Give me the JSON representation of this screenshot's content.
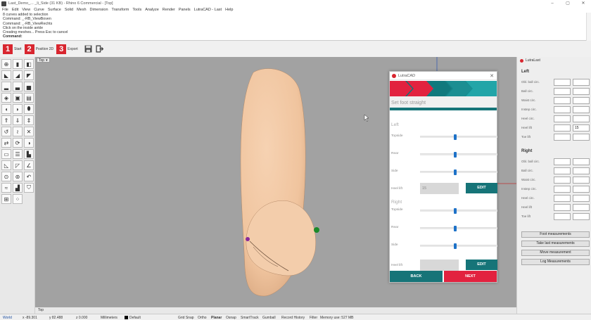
{
  "window": {
    "title": "Last_Demo_... _li_Side (31 KB) - Rhino 6 Commercial - [Top]",
    "controls": [
      "–",
      "▢",
      "✕"
    ]
  },
  "menu": [
    "File",
    "Edit",
    "View",
    "Curve",
    "Surface",
    "Solid",
    "Mesh",
    "Dimension",
    "Transform",
    "Tools",
    "Analyze",
    "Render",
    "Panels",
    "LutraCAD - Last",
    "Help"
  ],
  "command_history": [
    "8 curves added to selection",
    "Command: _-RB_ViewBoven",
    "Command: _-RB_ViewRechts",
    "Click on the inside ankle",
    "Creating meshes... Press Esc to cancel"
  ],
  "command_prompt": "Command:",
  "steps": [
    {
      "num": "1",
      "label": "Start"
    },
    {
      "num": "2",
      "label": "Position 2D"
    },
    {
      "num": "3",
      "label": "Export"
    }
  ],
  "toolbar_icons": [
    "save-icon",
    "exit-icon"
  ],
  "viewport": {
    "tab": "Top",
    "tab_arrow": "▾",
    "bottom_tab": "Top",
    "background": "#a2a2a2",
    "foot_color": "#f2caa6"
  },
  "dialog": {
    "title": "LutraCAD",
    "close": "✕",
    "section_title": "Set foot straight",
    "left": {
      "label": "Left",
      "rows": [
        {
          "label": "Topside",
          "value": 0.45
        },
        {
          "label": "Rear",
          "value": 0.45
        },
        {
          "label": "Side",
          "value": 0.45
        }
      ],
      "heel_lift_label": "Heel lift",
      "heel_lift_value": "15",
      "edit_label": "EDIT"
    },
    "right": {
      "label": "Right",
      "rows": [
        {
          "label": "Topside",
          "value": 0.45
        },
        {
          "label": "Rear",
          "value": 0.45
        },
        {
          "label": "Side",
          "value": 0.45
        }
      ],
      "heel_lift_label": "Heel lift",
      "heel_lift_value": "",
      "edit_label": "EDIT"
    },
    "back_label": "BACK",
    "next_label": "NEXT",
    "colors": {
      "teal": "#167478",
      "red": "#e2223f",
      "slider": "#1e72c8"
    }
  },
  "panel": {
    "title": "LutraLast",
    "left": {
      "label": "Left",
      "rows": [
        {
          "label": "Obl. ball circ.",
          "a": "",
          "b": ""
        },
        {
          "label": "Ball circ.",
          "a": "",
          "b": ""
        },
        {
          "label": "Waist circ.",
          "a": "",
          "b": ""
        },
        {
          "label": "Instep circ.",
          "a": "",
          "b": ""
        },
        {
          "label": "Heel circ.",
          "a": "",
          "b": ""
        },
        {
          "label": "Heel lift",
          "a": "",
          "b": "15"
        },
        {
          "label": "Toe lift",
          "a": "",
          "b": ""
        }
      ]
    },
    "right": {
      "label": "Right",
      "rows": [
        {
          "label": "Obl. ball circ.",
          "a": "",
          "b": ""
        },
        {
          "label": "Ball circ.",
          "a": "",
          "b": ""
        },
        {
          "label": "Waist circ.",
          "a": "",
          "b": ""
        },
        {
          "label": "Instep circ.",
          "a": "",
          "b": ""
        },
        {
          "label": "Heel circ.",
          "a": "",
          "b": ""
        },
        {
          "label": "Heel lift",
          "a": "",
          "b": ""
        },
        {
          "label": "Toe lift",
          "a": "",
          "b": ""
        }
      ]
    },
    "buttons": [
      "Foot measurements",
      "Take last measurements",
      "Move measurement",
      "Log Measurements"
    ]
  },
  "status": {
    "world": "World",
    "x": "x -89.301",
    "y": "y 82.488",
    "z": "z 0.000",
    "units": "Millimeters",
    "layer": "Default",
    "items": [
      "Grid Snap",
      "Ortho",
      "Planar",
      "Osnap",
      "SmartTrack",
      "Gumball",
      "Record History",
      "Filter",
      "Memory use: 527 MB"
    ]
  }
}
